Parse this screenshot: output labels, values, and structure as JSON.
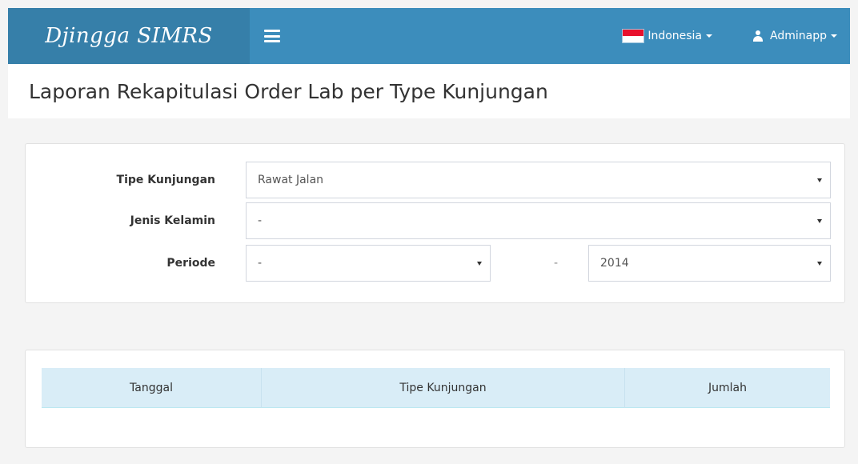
{
  "navbar": {
    "brand": "Djingga SIMRS",
    "language_label": "Indonesia",
    "user_label": "Adminapp"
  },
  "page": {
    "title": "Laporan Rekapitulasi Order Lab per Type Kunjungan"
  },
  "filters": {
    "tipe_kunjungan": {
      "label": "Tipe Kunjungan",
      "value": "Rawat Jalan"
    },
    "jenis_kelamin": {
      "label": "Jenis Kelamin",
      "value": "-"
    },
    "periode": {
      "label": "Periode",
      "month_value": "-",
      "separator": "-",
      "year_value": "2014"
    }
  },
  "table": {
    "columns": [
      "Tanggal",
      "Tipe Kunjungan",
      "Jumlah"
    ]
  },
  "colors": {
    "navbar": "#3c8dbc",
    "brand_bg": "#367fa9",
    "table_header": "#d9edf7"
  }
}
